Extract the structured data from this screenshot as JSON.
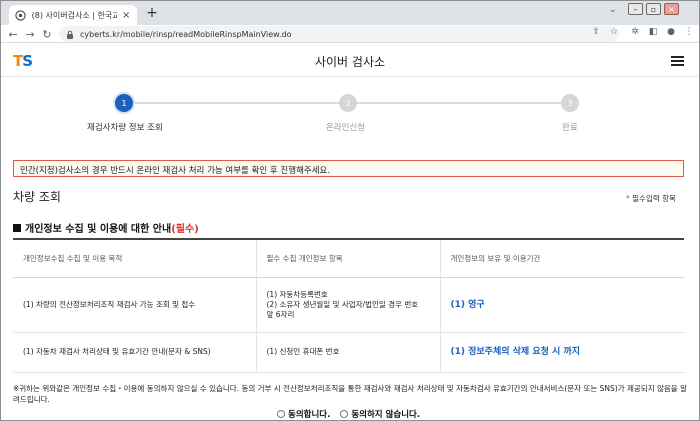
{
  "browser": {
    "tab_title": "(8) 사이버검사소 | 한국교통안전",
    "tab_close": "×",
    "new_tab": "+",
    "url": "cyberts.kr/mobile/rinsp/readMobileRinspMainView.do"
  },
  "header": {
    "logo_t": "T",
    "logo_s": "S",
    "title": "사이버 검사소"
  },
  "stepper": {
    "steps": [
      {
        "number": "1",
        "label": "재검사차량 정보 조회"
      },
      {
        "number": "2",
        "label": "온라인신청"
      },
      {
        "number": "3",
        "label": "완료"
      }
    ]
  },
  "notice": "민간(지정)검사소의 경우 반드시 온라인 재검사 처리 가능 여부를 확인 후 진행해주세요.",
  "section": {
    "title": "차량 조회",
    "required_star": "*",
    "required_text": "필수입력 항목",
    "sub_title": "개인정보 수집 및 이용에 대한 안내",
    "sub_title_required": "(필수)"
  },
  "table": {
    "headers": [
      "개인정보수집 수집 및 이용 목적",
      "필수 수집 개인정보 항목",
      "개인정보의 보유 및 이용기간"
    ],
    "rows": [
      {
        "purpose": "(1) 차량의 전산정보처리조직 재검사 가능 조회 및 접수",
        "items": [
          "(1) 자동차등록번호",
          "(2) 소유자 생년월일 및 사업자/법인일 경우 번호",
          "앞 6자리"
        ],
        "period": "(1) 영구"
      },
      {
        "purpose": "(1) 자동차 재검사 처리상태 및 유효기간 안내(문자 & SNS)",
        "items": [
          "(1) 신청인 휴대폰 번호"
        ],
        "period": "(1) 정보주체의 삭제 요청 시 까지"
      }
    ]
  },
  "footnote": "※귀하는 위와같은 개인정보 수집・이용에 동의하지 않으실 수 있습니다. 동의 거부 시 전산정보처리조직을 통한 재검사와 재검사 처리상태 및 자동차검사 유효기간의 안내서비스(문자 또는 SNS)가 제공되지 않음을 알려드립니다.",
  "consent": {
    "agree": "동의합니다.",
    "disagree": "동의하지 않습니다."
  },
  "colors": {
    "accent_blue": "#1d5fbf",
    "logo_orange": "#f08a00",
    "required_red": "#e03030",
    "notice_border": "#e05a4a"
  }
}
